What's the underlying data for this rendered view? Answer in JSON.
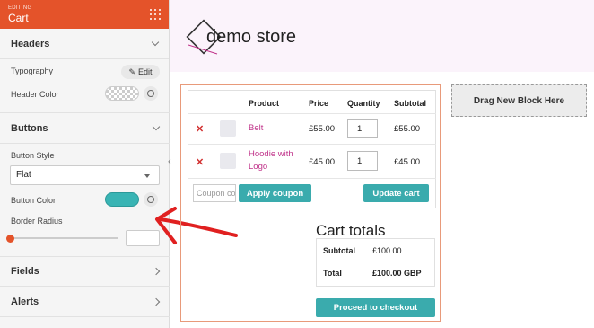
{
  "sidebar": {
    "header": {
      "small": "EDITING",
      "title": "Cart"
    },
    "sections": {
      "headers": "Headers",
      "buttons": "Buttons",
      "fields": "Fields",
      "alerts": "Alerts"
    },
    "props": {
      "typography": "Typography",
      "edit_label": "Edit",
      "header_color": "Header Color",
      "button_style": "Button Style",
      "button_style_value": "Flat",
      "button_color": "Button Color",
      "border_radius": "Border Radius"
    },
    "colors": {
      "accent": "#e4532a",
      "button": "#39b4b4"
    }
  },
  "store": {
    "logo_text": "demo store"
  },
  "cart": {
    "columns": [
      "Product",
      "Price",
      "Quantity",
      "Subtotal"
    ],
    "rows": [
      {
        "name": "Belt",
        "price": "£55.00",
        "qty": "1",
        "subtotal": "£55.00"
      },
      {
        "name_line1": "Hoodie with",
        "name_line2": "Logo",
        "price": "£45.00",
        "qty": "1",
        "subtotal": "£45.00"
      }
    ],
    "coupon_placeholder": "Coupon code",
    "apply_coupon": "Apply coupon",
    "update_cart": "Update cart",
    "totals_title": "Cart totals",
    "subtotal_label": "Subtotal",
    "subtotal_value": "£100.00",
    "total_label": "Total",
    "total_value": "£100.00 GBP",
    "checkout": "Proceed to checkout"
  },
  "drag_block": "Drag New Block Here"
}
